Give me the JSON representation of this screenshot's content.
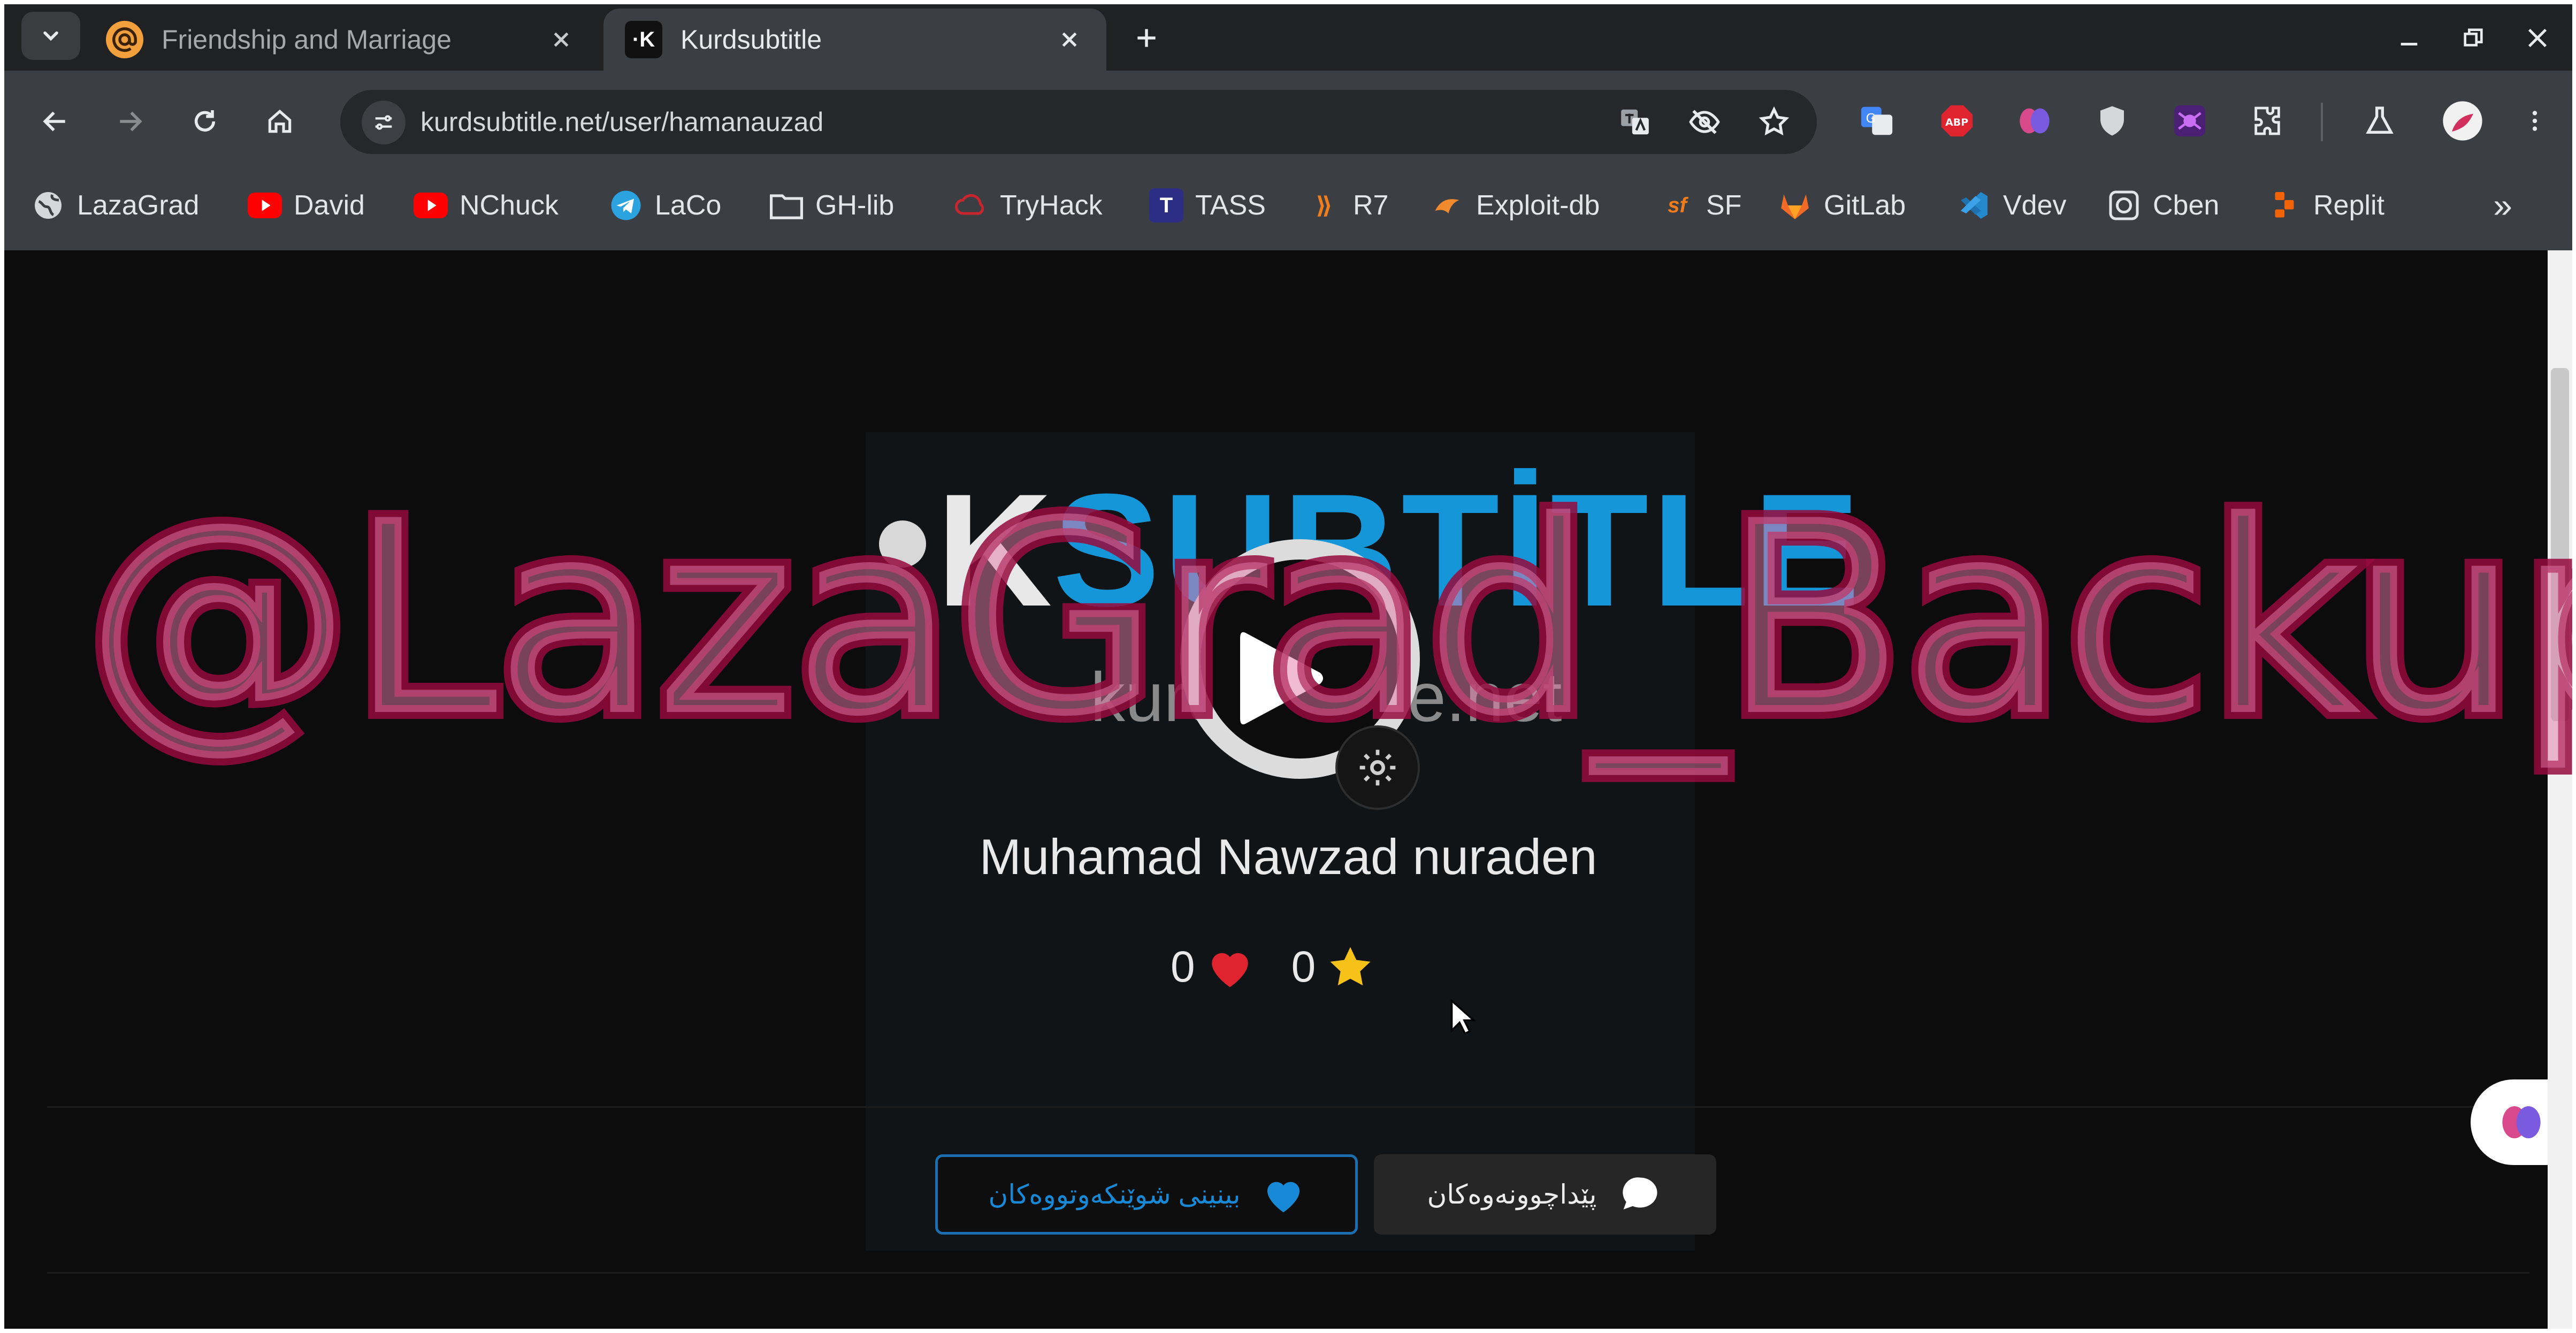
{
  "browser": {
    "tabs": [
      {
        "title": "Friendship and Marriage",
        "favicon": "at-sign-icon",
        "active": false
      },
      {
        "title": "Kurdsubtitle",
        "favicon": "ksubtitle-k-icon",
        "active": true
      }
    ],
    "url": "kurdsubtitle.net/user/hamanauzad",
    "bookmarks": [
      {
        "label": "LazaGrad",
        "icon": "globe-icon"
      },
      {
        "label": "David",
        "icon": "youtube-icon"
      },
      {
        "label": "NChuck",
        "icon": "youtube-icon"
      },
      {
        "label": "LaCo",
        "icon": "telegram-icon"
      },
      {
        "label": "GH-lib",
        "icon": "folder-icon"
      },
      {
        "label": "TryHack",
        "icon": "tryhackme-icon"
      },
      {
        "label": "TASS",
        "icon": "tass-icon"
      },
      {
        "label": "R7",
        "icon": "rapid7-icon"
      },
      {
        "label": "Exploit-db",
        "icon": "exploitdb-icon"
      },
      {
        "label": "SF",
        "icon": "sourceforge-icon"
      },
      {
        "label": "GitLab",
        "icon": "gitlab-icon"
      },
      {
        "label": "Vdev",
        "icon": "vscode-icon"
      },
      {
        "label": "Cben",
        "icon": "cben-icon"
      },
      {
        "label": "Replit",
        "icon": "replit-icon"
      }
    ],
    "bookmarks_more": "»",
    "extensions": [
      "translate-ext-icon",
      "adblock-ext-icon",
      "brain-ext-icon",
      "shield-ext-icon",
      "spider-ext-icon",
      "puzzle-ext-icon",
      "labs-flask-icon",
      "profile-avatar-icon",
      "kebab-menu-icon"
    ]
  },
  "profile": {
    "logo_k": "K",
    "logo_word": "SUBTİTLE",
    "logo_sub": "kurdsubtitle.net",
    "name": "Muhamad Nawzad nuraden",
    "likes": "0",
    "stars": "0",
    "follow_button": "بینینی شوێنکەوتووەکان",
    "reviews_button": "پێداچوونەوەکان"
  },
  "overlay": {
    "watermark": "@LazaGrad_Backup"
  },
  "colors": {
    "accent_blue": "#1789d6",
    "heart_red": "#e0242f",
    "star_yellow": "#f6c21a",
    "watermark_stroke": "#960a3c"
  }
}
